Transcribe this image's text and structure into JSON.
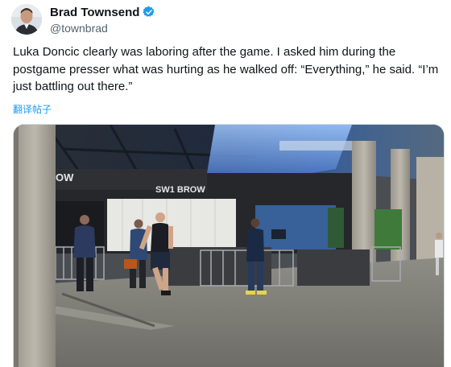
{
  "author": {
    "display_name": "Brad Townsend",
    "handle": "@townbrad",
    "verified": true
  },
  "tweet": {
    "text": "Luka Doncic clearly was laboring after the game. I asked him during the postgame presser what was hurting as he walked off: “Everything,” he said. “I’m just battling out there.”",
    "translate_label": "翻译帖子"
  },
  "media": {
    "wall_sign_left": "OW",
    "wall_sign_right": "SW1 BROW"
  },
  "colors": {
    "link": "#1d9bf0",
    "text": "#0f1419",
    "secondary": "#536471",
    "verified_badge": "#1d9bf0"
  },
  "icons": {
    "verified": "verified-badge-icon"
  }
}
